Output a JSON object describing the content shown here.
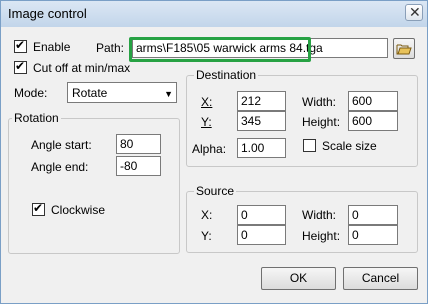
{
  "window": {
    "title": "Image control",
    "close_glyph": "✕"
  },
  "general": {
    "enable": {
      "label": "Enable",
      "checked": true
    },
    "path": {
      "label": "Path:",
      "value": "arms\\F185\\05 warwick arms 84.tga",
      "browse_icon": "folder-open-icon"
    },
    "cutoff": {
      "label": "Cut off at min/max",
      "checked": true
    },
    "mode": {
      "label": "Mode:",
      "value": "Rotate",
      "arrow": "▼"
    }
  },
  "rotation": {
    "title": "Rotation",
    "angle_start": {
      "label": "Angle start:",
      "value": "80"
    },
    "angle_end": {
      "label": "Angle end:",
      "value": "-80"
    },
    "clockwise": {
      "label": "Clockwise",
      "checked": true
    }
  },
  "destination": {
    "title": "Destination",
    "x": {
      "label": "X:",
      "value": "212"
    },
    "y": {
      "label": "Y:",
      "value": "345"
    },
    "width": {
      "label": "Width:",
      "value": "600"
    },
    "height": {
      "label": "Height:",
      "value": "600"
    },
    "alpha": {
      "label": "Alpha:",
      "value": "1.00"
    },
    "scale_size": {
      "label": "Scale size",
      "checked": false
    }
  },
  "source": {
    "title": "Source",
    "x": {
      "label": "X:",
      "value": "0"
    },
    "y": {
      "label": "Y:",
      "value": "0"
    },
    "width": {
      "label": "Width:",
      "value": "0"
    },
    "height": {
      "label": "Height:",
      "value": "0"
    }
  },
  "buttons": {
    "ok": "OK",
    "cancel": "Cancel"
  },
  "colors": {
    "highlight": "#27a244",
    "titlebar": "#c2d5ea"
  }
}
